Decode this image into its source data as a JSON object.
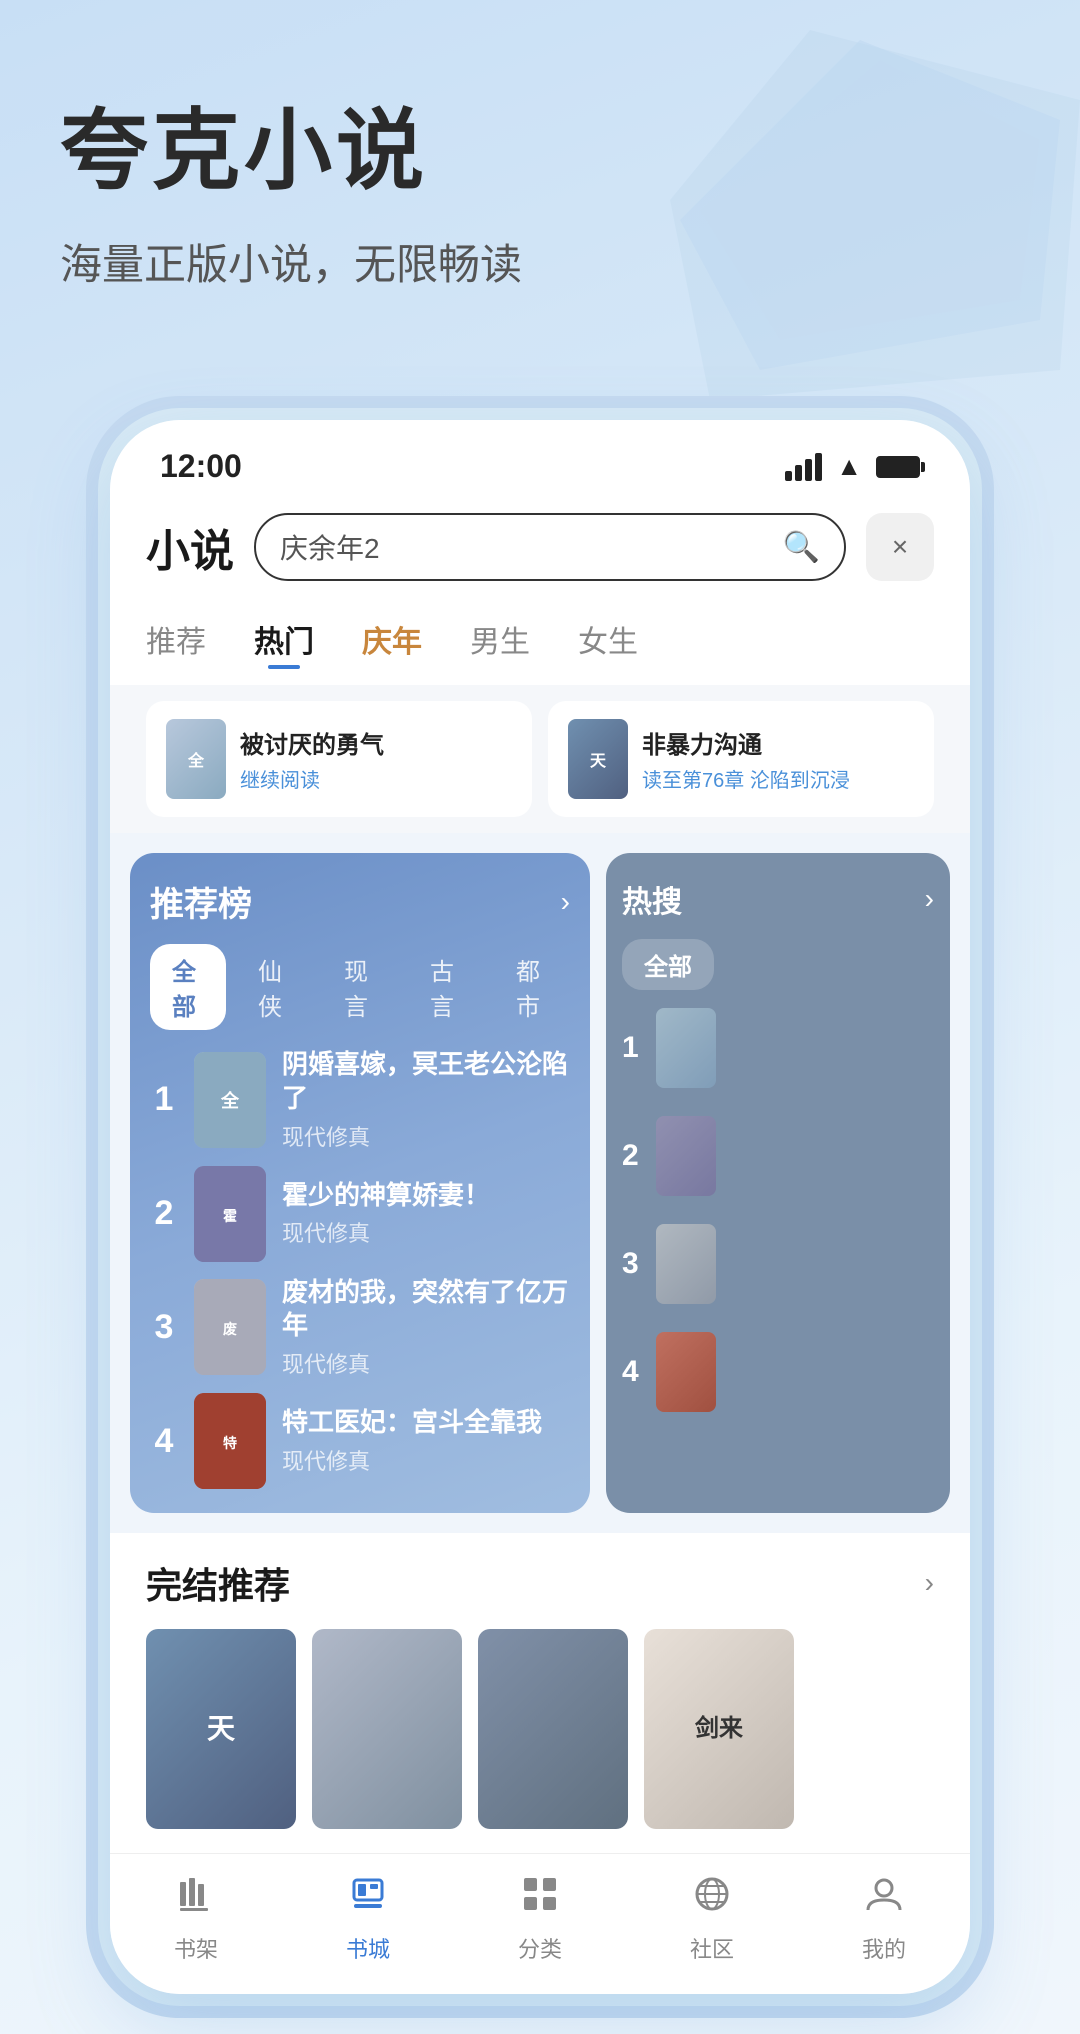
{
  "app": {
    "title": "夸克小说",
    "subtitle": "海量正版小说，无限畅读"
  },
  "status_bar": {
    "time": "12:00",
    "signal": "signal",
    "wifi": "wifi",
    "battery": "battery"
  },
  "header": {
    "app_name": "小说",
    "search_placeholder": "庆余年2",
    "close_label": "×"
  },
  "nav_tabs": [
    {
      "label": "推荐",
      "active": false,
      "special": false
    },
    {
      "label": "热门",
      "active": true,
      "special": false
    },
    {
      "label": "庆年",
      "active": false,
      "special": true
    },
    {
      "label": "男生",
      "active": false,
      "special": false
    },
    {
      "label": "女生",
      "active": false,
      "special": false
    }
  ],
  "recent_reads": [
    {
      "title": "被讨厌的勇气",
      "action": "继续阅读",
      "cover_color": "cover-1",
      "cover_text": "全"
    },
    {
      "title": "非暴力沟通",
      "action": "读至第76章 沦陷到沉浸",
      "cover_color": "cover-grid1",
      "cover_text": "天"
    }
  ],
  "recommend_panel": {
    "title": "推荐榜",
    "arrow": "›",
    "filters": [
      "全部",
      "仙侠",
      "现言",
      "古言",
      "都市"
    ],
    "active_filter": "全部",
    "books": [
      {
        "rank": "1",
        "title": "阴婚喜嫁，冥王老公沦陷了",
        "tag": "现代修真",
        "cover_color": "cover-1"
      },
      {
        "rank": "2",
        "title": "霍少的神算娇妻！",
        "tag": "现代修真",
        "cover_color": "cover-2"
      },
      {
        "rank": "3",
        "title": "废材的我，突然有了亿万年",
        "tag": "现代修真",
        "cover_color": "cover-3"
      },
      {
        "rank": "4",
        "title": "特工医妃：宫斗全靠我",
        "tag": "现代修真",
        "cover_color": "cover-4"
      }
    ]
  },
  "hot_panel": {
    "title": "热搜",
    "arrow": "›",
    "filters": [
      "全部"
    ],
    "ranks": [
      "1",
      "2",
      "3",
      "4"
    ]
  },
  "completed_section": {
    "title": "完结推荐",
    "arrow": "›",
    "books": [
      {
        "cover_color": "cover-grid1",
        "text": "天"
      },
      {
        "cover_color": "cover-grid2",
        "text": ""
      },
      {
        "cover_color": "cover-grid3",
        "text": ""
      },
      {
        "cover_color": "cover-grid4",
        "text": "剑来"
      }
    ]
  },
  "bottom_nav": [
    {
      "label": "书架",
      "icon": "📚",
      "active": false
    },
    {
      "label": "书城",
      "icon": "📖",
      "active": true
    },
    {
      "label": "分类",
      "icon": "⊞",
      "active": false
    },
    {
      "label": "社区",
      "icon": "🌐",
      "active": false
    },
    {
      "label": "我的",
      "icon": "👤",
      "active": false
    }
  ]
}
